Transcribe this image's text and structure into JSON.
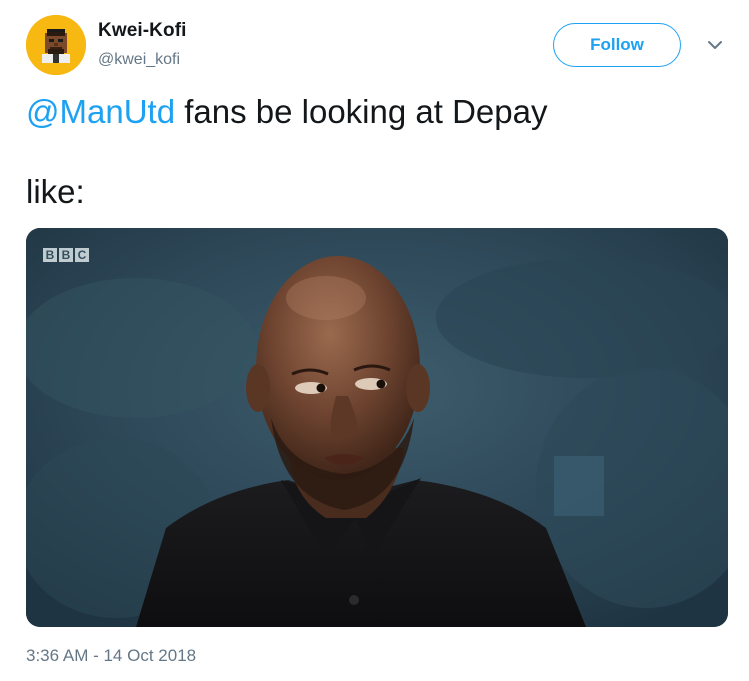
{
  "user": {
    "display_name": "Kwei-Kofi",
    "handle": "@kwei_kofi"
  },
  "actions": {
    "follow_label": "Follow",
    "more_icon": "chevron-down-icon"
  },
  "tweet": {
    "mention": "@ManUtd",
    "text_after_mention": " fans be looking at Depay",
    "text_line2": "like:",
    "timestamp": "3:36 AM - 14 Oct 2018"
  },
  "media": {
    "watermark_letters": [
      "B",
      "B",
      "C"
    ]
  },
  "colors": {
    "accent": "#1da1f2",
    "text_primary": "#14171a",
    "text_secondary": "#657786",
    "avatar_bg": "#f7b812"
  }
}
